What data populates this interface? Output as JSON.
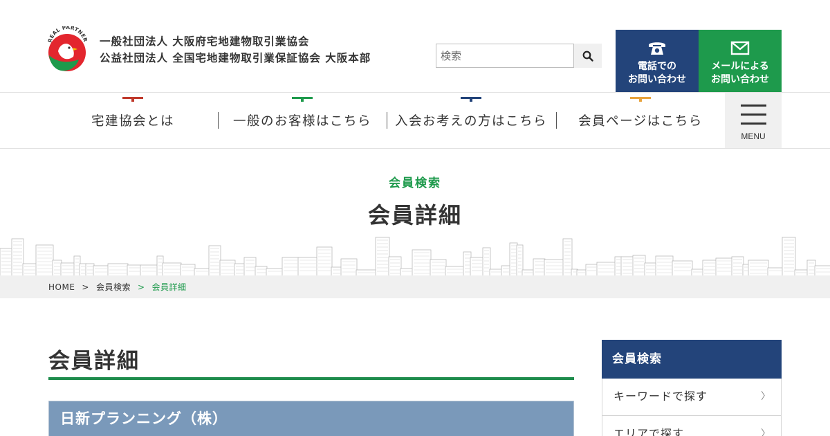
{
  "header": {
    "logo_text": "REAL PARTNER",
    "org_line1": "一般社団法人 大阪府宅地建物取引業協会",
    "org_line2": "公益社団法人 全国宅地建物取引業保証協会 大阪本部",
    "search_placeholder": "検索",
    "phone": {
      "line1": "電話での",
      "line2": "お問い合わせ",
      "icon": "phone-icon"
    },
    "mail": {
      "line1": "メールによる",
      "line2": "お問い合わせ",
      "icon": "mail-icon"
    }
  },
  "nav": {
    "items": [
      {
        "label": "宅建協会とは",
        "color": "#c0392b"
      },
      {
        "label": "一般のお客様はこちら",
        "color": "#1e9a4c"
      },
      {
        "label": "入会お考えの方はこちら",
        "color": "#23447a"
      },
      {
        "label": "会員ページはこちら",
        "color": "#e8a33d"
      }
    ],
    "menu_label": "MENU"
  },
  "hero": {
    "subtitle": "会員検索",
    "title": "会員詳細"
  },
  "breadcrumb": {
    "home": "HOME",
    "sep": ">",
    "parent": "会員検索",
    "current": "会員詳細"
  },
  "main": {
    "title": "会員詳細",
    "company_name": "日新プランニング（株）"
  },
  "sidebar": {
    "heading": "会員検索",
    "items": [
      {
        "label": "キーワードで探す"
      },
      {
        "label": "エリアで探す"
      }
    ]
  },
  "colors": {
    "navy": "#23447a",
    "green": "#1e9a4c",
    "company_bar": "#7a99ba",
    "logo_red": "#e3262e"
  }
}
